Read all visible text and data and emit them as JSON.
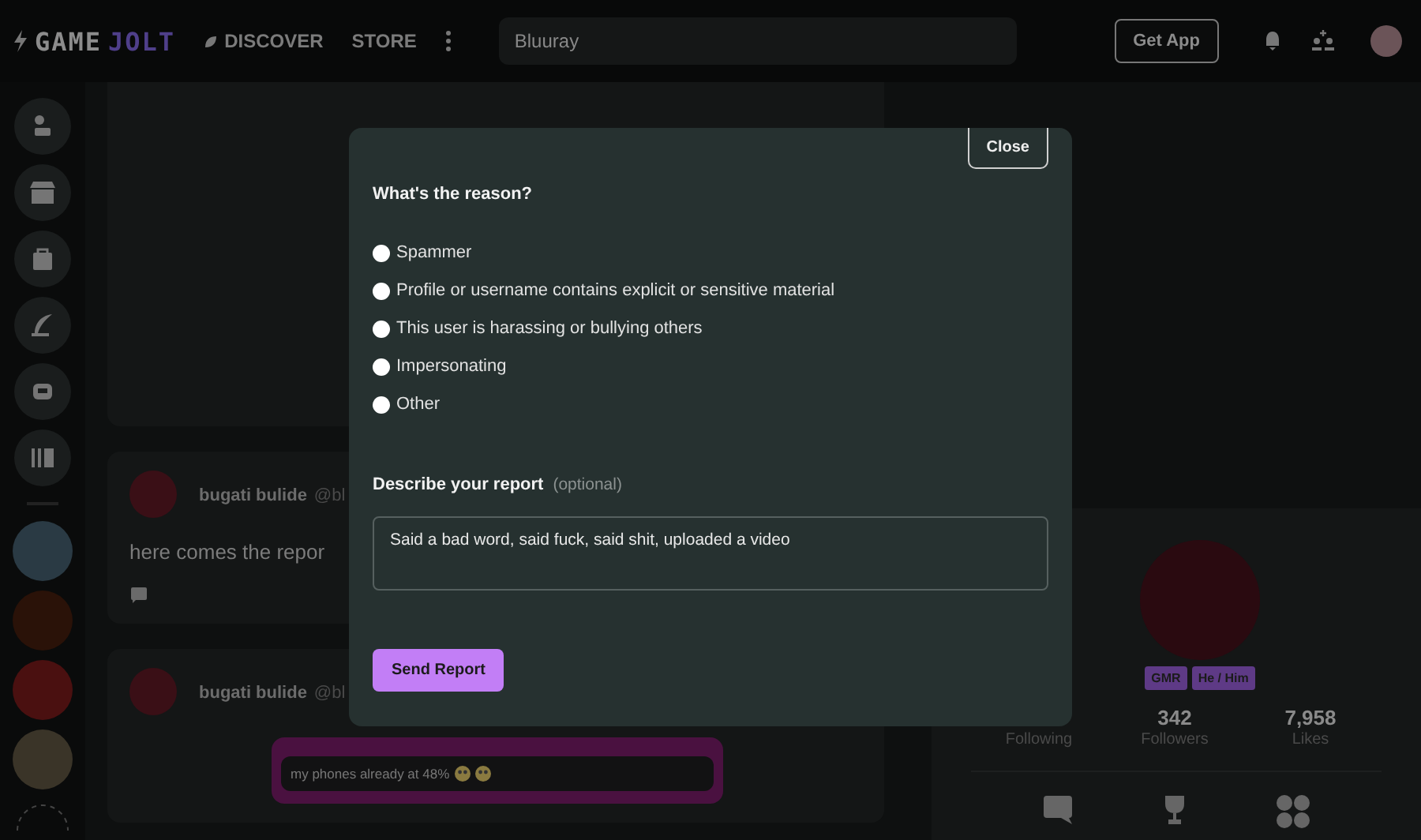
{
  "header": {
    "logo": {
      "first": "GAME",
      "second": "JOLT"
    },
    "nav": [
      {
        "label": "DISCOVER",
        "kind": "discover"
      },
      {
        "label": "STORE",
        "kind": "plain"
      }
    ],
    "search": {
      "value": "Bluuray"
    },
    "get_app": "Get App"
  },
  "feed": {
    "posts": [
      {
        "author": "bugati bulide",
        "handle": "@bl",
        "body": "here comes the repor"
      },
      {
        "author": "bugati bulide",
        "handle": "@bl",
        "bubble": "my phones already at 48%"
      }
    ]
  },
  "profile": {
    "badges": [
      "GMR",
      "He / Him"
    ],
    "stats": [
      {
        "label": "Following"
      },
      {
        "value": "342",
        "label": "Followers"
      },
      {
        "value": "7,958",
        "label": "Likes"
      }
    ]
  },
  "report_dialog": {
    "close": "Close",
    "question": "What's the reason?",
    "reasons": [
      {
        "label": "Spammer",
        "selected": false
      },
      {
        "label": "Profile or username contains explicit or sensitive material",
        "selected": false
      },
      {
        "label": "This user is harassing or bullying others",
        "selected": false
      },
      {
        "label": "Impersonating",
        "selected": false
      },
      {
        "label": "Other",
        "selected": false
      }
    ],
    "describe_label": "Describe your report",
    "describe_hint": "(optional)",
    "description": "Said a bad word, said fuck, said shit, uploaded a video",
    "send": "Send Report"
  }
}
